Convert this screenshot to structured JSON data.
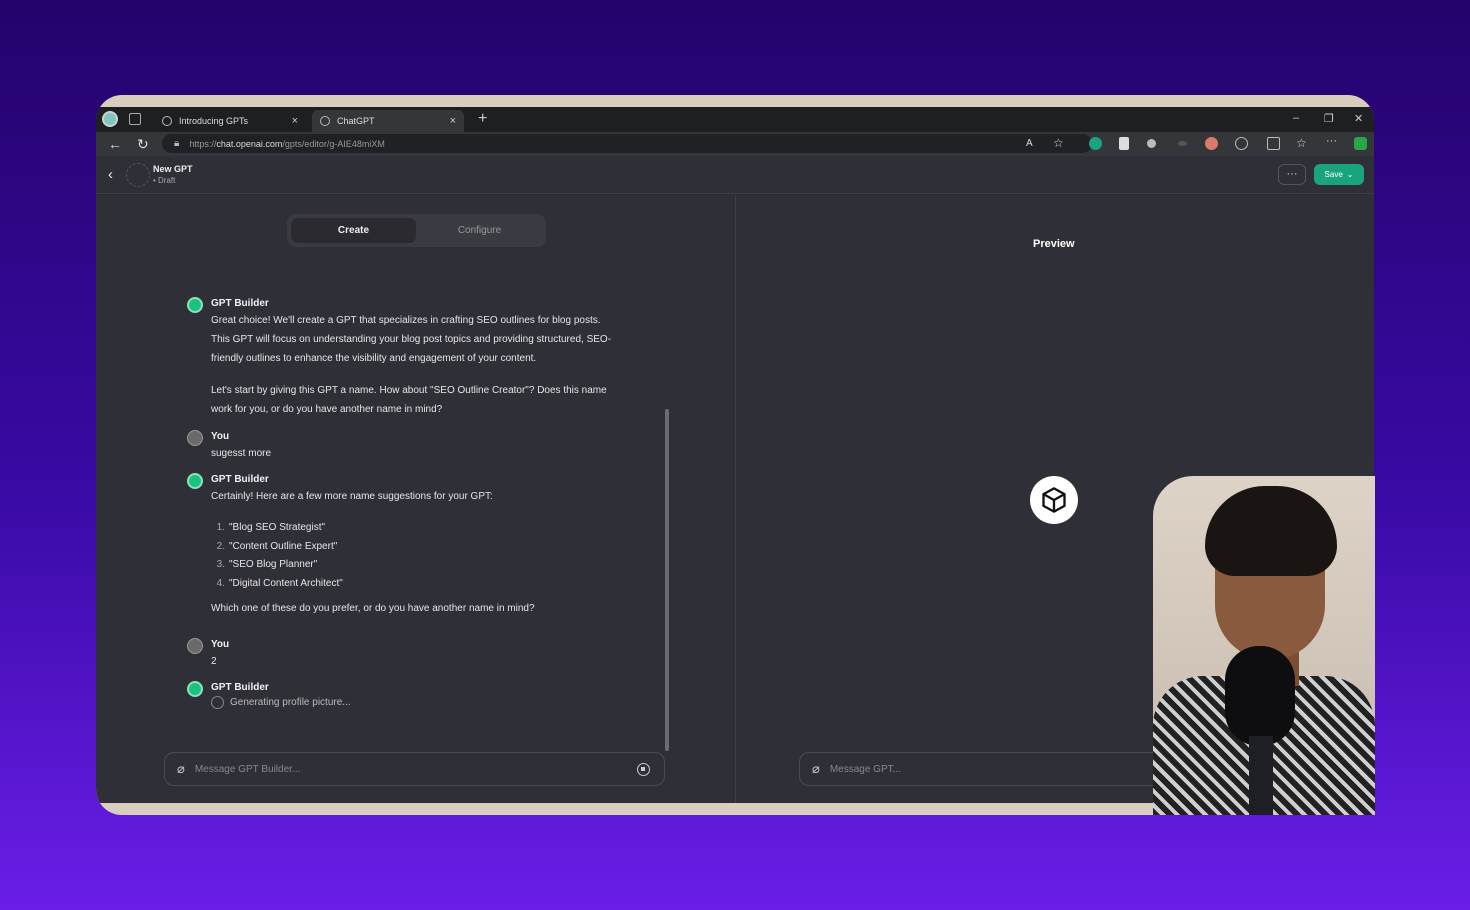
{
  "browser": {
    "tabs": [
      {
        "label": "Introducing GPTs"
      },
      {
        "label": "ChatGPT"
      }
    ],
    "url_prefix": "https://",
    "url_host": "chat.openai.com",
    "url_path": "/gpts/editor/g-AIE48miXM",
    "controls": {
      "minimize": "–",
      "restore": "❐",
      "close": "✕",
      "new_tab": "+"
    }
  },
  "header": {
    "name": "New GPT",
    "status": "• Draft",
    "more_label": "···",
    "save_label": "Save"
  },
  "segmented": {
    "create": "Create",
    "configure": "Configure"
  },
  "conversation": [
    {
      "author": "GPT Builder",
      "paragraph1": [
        "Great choice! We'll create a GPT that specializes in crafting SEO outlines for blog posts.",
        "This GPT will focus on understanding your blog post topics and providing structured, SEO-",
        "friendly outlines to enhance the visibility and engagement of your content."
      ],
      "paragraph2": [
        "Let's start by giving this GPT a name. How about \"SEO Outline Creator\"? Does this name",
        "work for you, or do you have another name in mind?"
      ]
    },
    {
      "author": "You",
      "text": "sugesst more"
    },
    {
      "author": "GPT Builder",
      "intro": "Certainly! Here are a few more name suggestions for your GPT:",
      "list": [
        "\"Blog SEO Strategist\"",
        "\"Content Outline Expert\"",
        "\"SEO Blog Planner\"",
        "\"Digital Content Architect\""
      ],
      "outro": "Which one of these do you prefer, or do you have another name in mind?"
    },
    {
      "author": "You",
      "text": "2"
    },
    {
      "author": "GPT Builder",
      "status": "Generating profile picture..."
    }
  ],
  "builder_input": {
    "placeholder": "Message GPT Builder..."
  },
  "preview": {
    "title": "Preview",
    "input_placeholder": "Message GPT..."
  }
}
